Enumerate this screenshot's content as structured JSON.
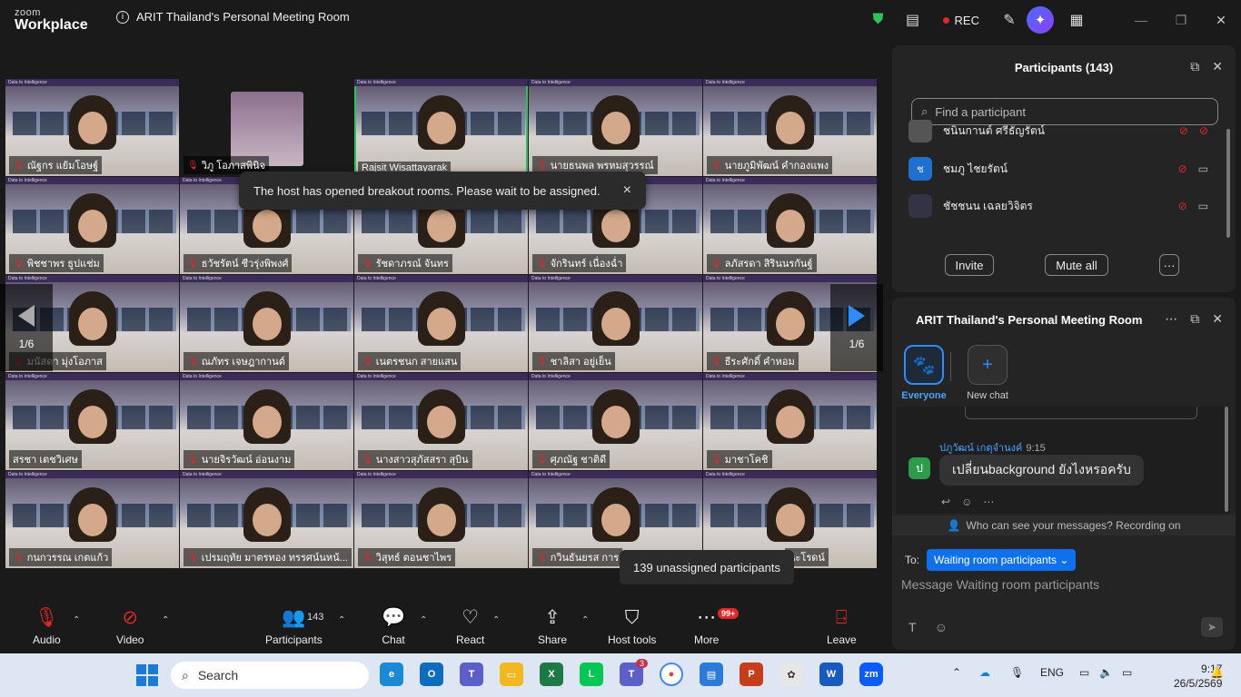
{
  "app": {
    "brand_line1": "zoom",
    "brand_line2": "Workplace",
    "meeting_title": "ARIT Thailand's Personal Meeting Room",
    "rec_label": "REC"
  },
  "colors": {
    "accent": "#2d8cff",
    "danger": "#e02828",
    "active_speaker": "#2dc35b"
  },
  "tiles": [
    {
      "name": "ณัฐกร แย้มโอษฐ์"
    },
    {
      "name": "วิภู โอภาสพินิจ"
    },
    {
      "name": "Rajsit Wisattayarak"
    },
    {
      "name": "นายธนพล พรหมสุวรรณ์"
    },
    {
      "name": "นายภูมิพัฒน์ คำกองแพง"
    },
    {
      "name": "พิชชาพร ธูปแช่ม"
    },
    {
      "name": "ธวัชรัตน์ ชีวรุ่งพิพงศ์"
    },
    {
      "name": "รัชดาภรณ์ จันทร"
    },
    {
      "name": "จักรินทร์ เนื่องฉ่ำ"
    },
    {
      "name": "ลภัสรดา สิรินนรกันฐ์"
    },
    {
      "name": "มนัสดา มุ่งโอภาส"
    },
    {
      "name": "ณภัทร เจษฎากานต์"
    },
    {
      "name": "เนตรชนก สายแสน"
    },
    {
      "name": "ชาลิสา อยู่เย็น"
    },
    {
      "name": "ธีระศักดิ์ คำหอม"
    },
    {
      "name": "สรชา เตชวิเศษ"
    },
    {
      "name": "นายจิรวัฒน์ อ่อนงาม"
    },
    {
      "name": "นางสาวสุภัสสรา สุบิน"
    },
    {
      "name": "ศุภณัฐ ชาติดี"
    },
    {
      "name": "มาชาโคชิ"
    },
    {
      "name": "กนกวรรณ เกตแก้ว"
    },
    {
      "name": "เปรมฤทัย มาตรทอง ทรรศน์นหน้..."
    },
    {
      "name": "วิสุทธ์ ตอนชาไพร"
    },
    {
      "name": "กวินธันยรส การ"
    },
    {
      "name": "นะโรดน์"
    }
  ],
  "toast": {
    "text": "The host has opened breakout rooms. Please wait to be assigned.",
    "close": "×"
  },
  "pager": {
    "left": "1/6",
    "right": "1/6"
  },
  "unassigned": "139 unassigned participants",
  "toolbar": {
    "audio": "Audio",
    "video": "Video",
    "participants": "Participants",
    "participants_count": "143",
    "chat": "Chat",
    "react": "React",
    "share": "Share",
    "host_tools": "Host tools",
    "more": "More",
    "more_badge": "99+",
    "leave": "Leave"
  },
  "participants_panel": {
    "title": "Participants (143)",
    "search_placeholder": "Find a participant",
    "rows": [
      {
        "name": "ชนินกานต์ ศรีธัญรัตน์",
        "initial": ""
      },
      {
        "name": "ชมภู ไชยรัตน์",
        "initial": "ช"
      },
      {
        "name": "ชัชชนน เฉลยวิจิตร",
        "initial": ""
      }
    ],
    "invite": "Invite",
    "mute_all": "Mute all",
    "more": "···"
  },
  "chat_panel": {
    "title": "ARIT Thailand's Personal Meeting Room",
    "tab_everyone": "Everyone",
    "tab_new_chat": "New chat",
    "message": {
      "sender": "ปภูวัฒน์ เกตุจำนงค์",
      "time": "9:15",
      "avatar": "ป",
      "text": "เปลี่ยนbackground ยังไงหรอครับ"
    },
    "who_can_see": "Who can see your messages? Recording on",
    "to_label": "To:",
    "to_value": "Waiting room participants",
    "input_placeholder": "Message Waiting room participants"
  },
  "taskbar": {
    "search": "Search",
    "lang": "ENG",
    "time": "9:17",
    "date": "26/5/2569",
    "teams_badge": "3"
  }
}
